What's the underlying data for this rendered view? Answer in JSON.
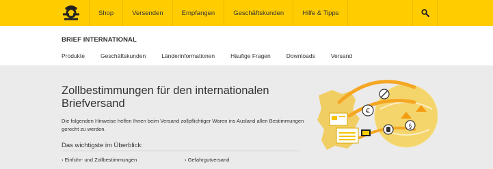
{
  "nav": {
    "items": [
      "Shop",
      "Versenden",
      "Empfangen",
      "Geschäftskunden",
      "Hilfe & Tipps"
    ]
  },
  "subnav": {
    "title": "BRIEF INTERNATIONAL",
    "items": [
      "Produkte",
      "Geschäftskunden",
      "Länderinformationen",
      "Häufige Fragen",
      "Downloads",
      "Versand"
    ]
  },
  "main": {
    "headline": "Zollbestimmungen für den internationalen Briefversand",
    "intro": "Die folgenden Hinweise helfen Ihnen beim Versand zollpflichtiger Waren ins Ausland allen Bestimmungen gerecht zu werden.",
    "overview_title": "Das wichtigste im Überblick:",
    "links": [
      "› Einfuhr- und Zollbestimmungen",
      "› Gefahrgutversand"
    ]
  },
  "colors": {
    "brand_yellow": "#ffcc00",
    "accent_orange": "#f5a623",
    "text": "#323232"
  },
  "icons": [
    "post-horn-logo-icon",
    "search-icon",
    "euro-icon",
    "paragraph-icon",
    "forbidden-icon",
    "hand-icon"
  ]
}
